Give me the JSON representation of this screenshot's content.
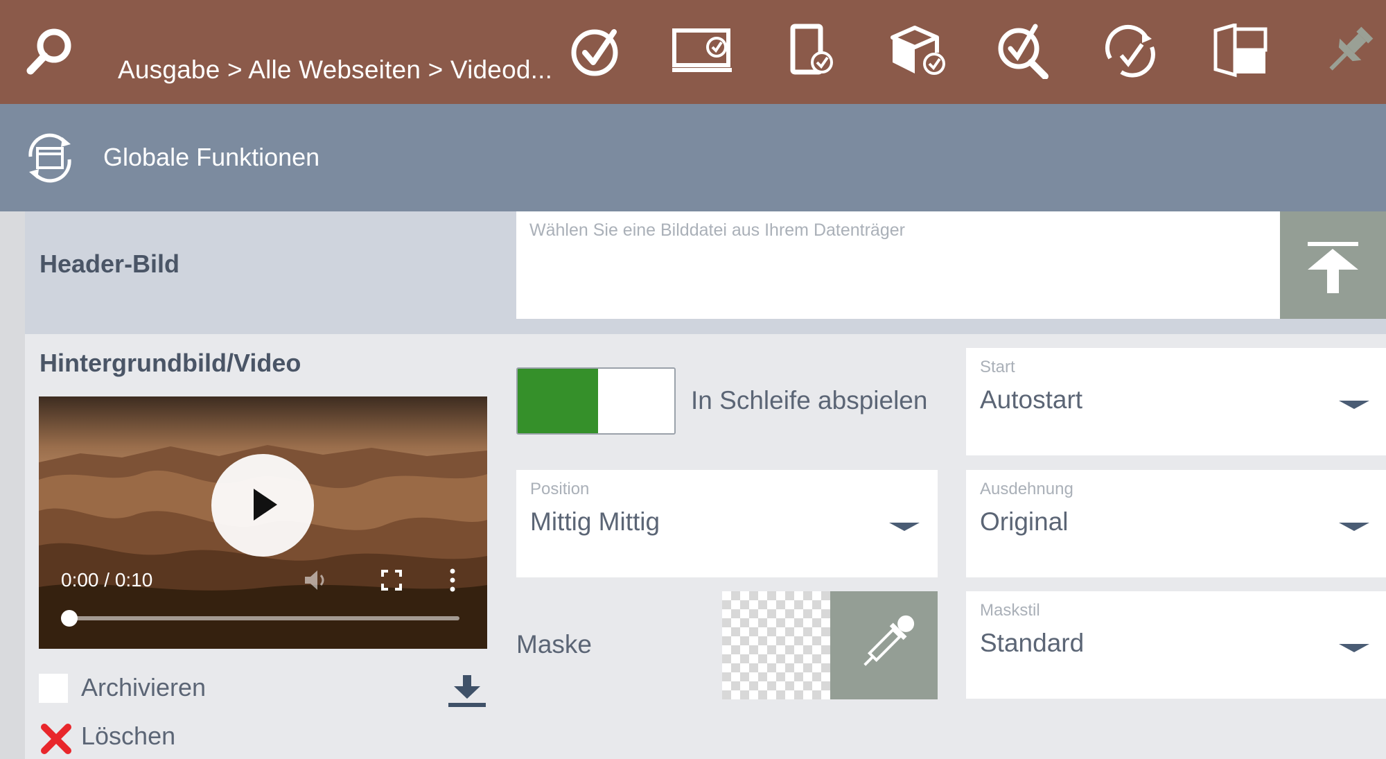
{
  "toolbar": {
    "breadcrumb": "Ausgabe > Alle Webseiten > Videod...",
    "icons": [
      "search-icon",
      "check-circle-icon",
      "monitor-check-icon",
      "tablet-check-icon",
      "box-check-icon",
      "magnify-check-icon",
      "sync-check-icon",
      "cabinet-icon",
      "pin-icon"
    ]
  },
  "global": {
    "title": "Globale Funktionen"
  },
  "header_image": {
    "label": "Header-Bild",
    "placeholder": "Wählen Sie eine Bilddatei aus Ihrem Datenträger"
  },
  "background": {
    "label": "Hintergrundbild/Video",
    "video": {
      "time": "0:00 / 0:10",
      "progress": 0
    },
    "archive_label": "Archivieren",
    "archive_checked": false,
    "delete_label": "Löschen"
  },
  "loop": {
    "label": "In Schleife abspielen",
    "enabled": true
  },
  "start": {
    "label": "Start",
    "value": "Autostart"
  },
  "position": {
    "label": "Position",
    "value": "Mittig Mittig"
  },
  "ausdehnung": {
    "label": "Ausdehnung",
    "value": "Original"
  },
  "mask": {
    "label": "Maske"
  },
  "maskstil": {
    "label": "Maskstil",
    "value": "Standard"
  },
  "colors": {
    "topbar": "#8b5a4a",
    "globalbar": "#7c8b9f",
    "toggle_on": "#35902a",
    "delete": "#e8262b"
  }
}
